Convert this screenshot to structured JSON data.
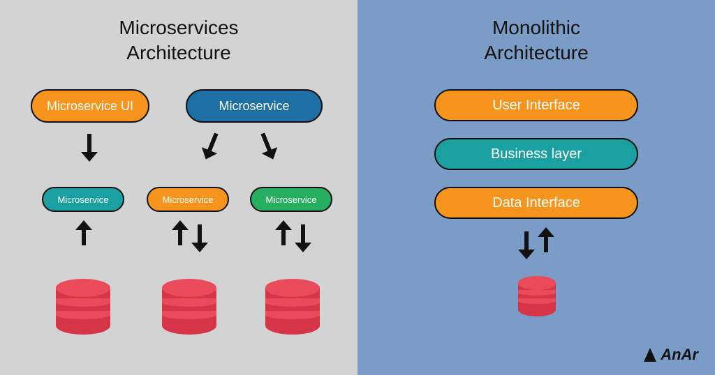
{
  "left": {
    "title_line1": "Microservices",
    "title_line2": "Architecture",
    "top_nodes": [
      {
        "label": "Microservice UI",
        "color": "orange"
      },
      {
        "label": "Microservice",
        "color": "blue"
      }
    ],
    "mid_nodes": [
      {
        "label": "Microservice",
        "color": "teal"
      },
      {
        "label": "Microservice",
        "color": "orange"
      },
      {
        "label": "Microservice",
        "color": "green"
      }
    ]
  },
  "right": {
    "title_line1": "Monolithic",
    "title_line2": "Architecture",
    "layers": [
      {
        "label": "User Interface",
        "color": "orange"
      },
      {
        "label": "Business layer",
        "color": "teal"
      },
      {
        "label": "Data Interface",
        "color": "orange"
      }
    ]
  },
  "branding": {
    "text": "AnAr"
  },
  "colors": {
    "left_bg": "#d3d3d3",
    "right_bg": "#7a9cc6",
    "orange": "#f7941d",
    "blue": "#1d6fa5",
    "teal": "#1aa0a0",
    "green": "#27ae60",
    "db_fill": "#d63447",
    "db_top": "#e94b5a"
  }
}
